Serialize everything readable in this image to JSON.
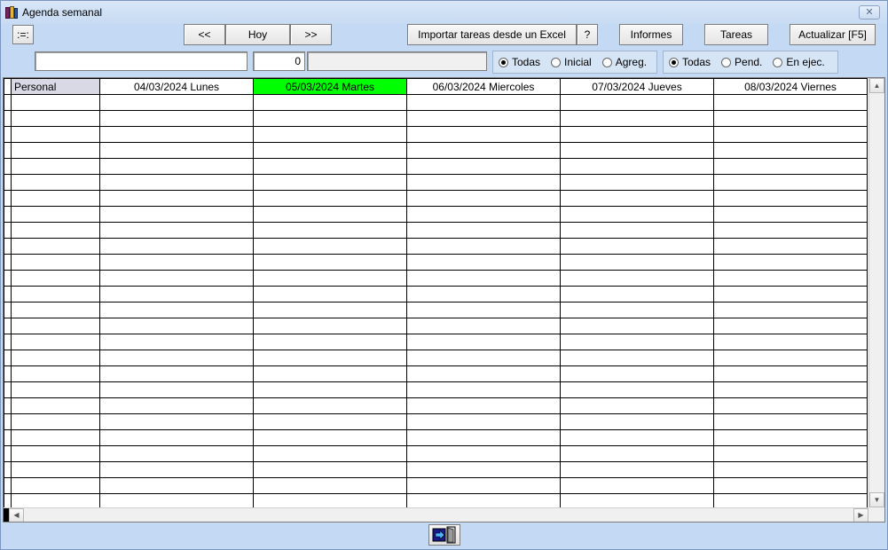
{
  "window": {
    "title": "Agenda semanal",
    "close_label": "✕"
  },
  "toolbar": {
    "menu_label": ":=:",
    "prev_label": "<<",
    "today_label": "Hoy",
    "next_label": ">>",
    "import_label": "Importar tareas desde un Excel",
    "help_label": "?",
    "reports_label": "Informes",
    "tasks_label": "Tareas",
    "refresh_label": "Actualizar [F5]"
  },
  "filters": {
    "search_value": "",
    "count_value": "0",
    "status_value": "",
    "group1": [
      {
        "label": "Todas",
        "checked": true
      },
      {
        "label": "Inicial",
        "checked": false
      },
      {
        "label": "Agreg.",
        "checked": false
      }
    ],
    "group2": [
      {
        "label": "Todas",
        "checked": true
      },
      {
        "label": "Pend.",
        "checked": false
      },
      {
        "label": "En ejec.",
        "checked": false
      }
    ]
  },
  "grid": {
    "columns": [
      {
        "label": "Personal"
      },
      {
        "label": "04/03/2024 Lunes"
      },
      {
        "label": "05/03/2024 Martes"
      },
      {
        "label": "06/03/2024 Miercoles"
      },
      {
        "label": "07/03/2024 Jueves"
      },
      {
        "label": "08/03/2024 Viernes"
      }
    ],
    "today_column": 2,
    "today_color": "#00ff00",
    "header_first_color": "#d9d9e6",
    "row_count": 26
  },
  "footer": {
    "exit_icon": "exit-door-icon"
  }
}
